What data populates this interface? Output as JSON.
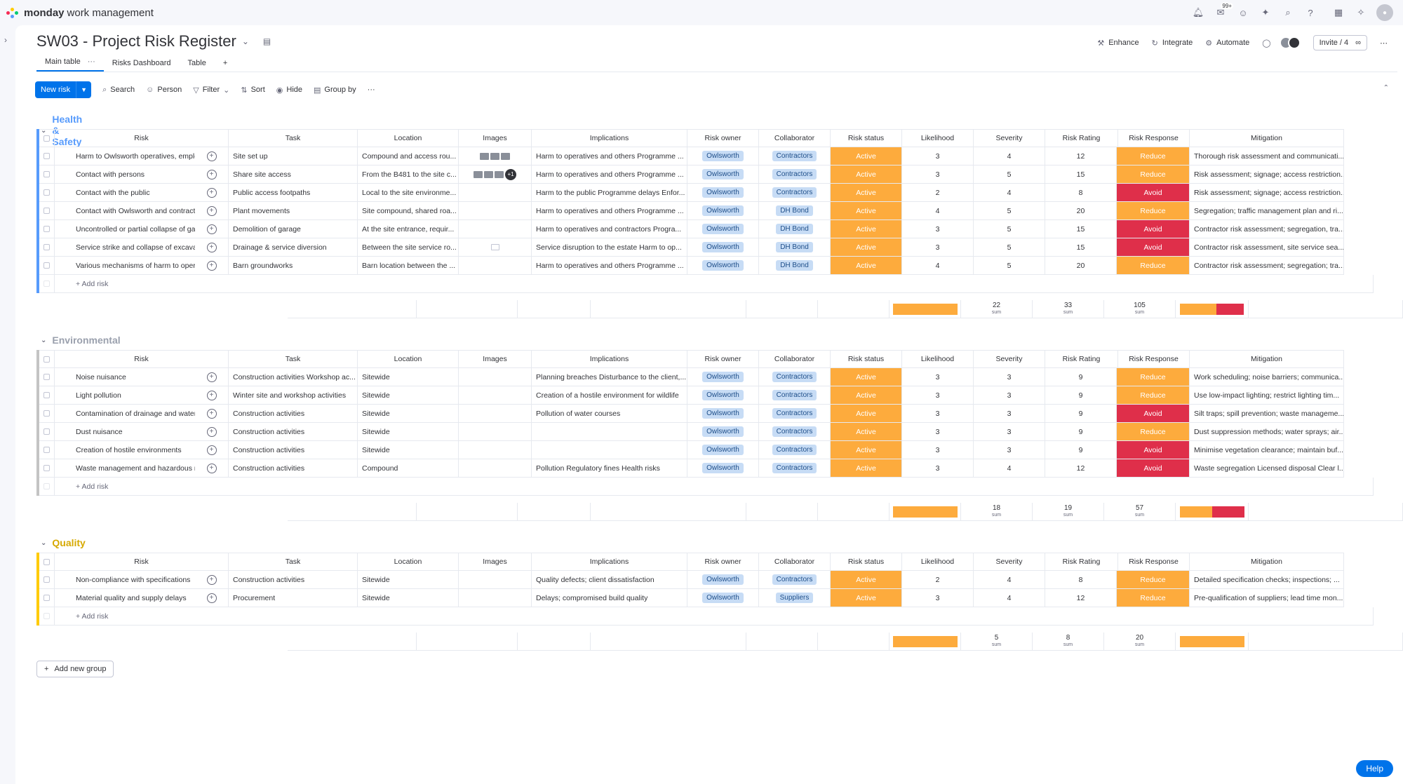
{
  "app": {
    "brand": "monday",
    "brand_sub": "work management"
  },
  "topbar": {
    "notifications_badge": "99+"
  },
  "board": {
    "title": "SW03 - Project Risk Register",
    "views": [
      {
        "label": "Main table",
        "active": true
      },
      {
        "label": "Risks Dashboard",
        "active": false
      },
      {
        "label": "Table",
        "active": false
      }
    ],
    "add_view": "+",
    "actions": {
      "enhance": "Enhance",
      "integrate": "Integrate",
      "automate": "Automate",
      "invite": "Invite / 4"
    }
  },
  "toolbar": {
    "new_label": "New risk",
    "search": "Search",
    "person": "Person",
    "filter": "Filter",
    "sort": "Sort",
    "hide": "Hide",
    "group_by": "Group by",
    "more": "···"
  },
  "columns": [
    "Risk",
    "Task",
    "Location",
    "Images",
    "Implications",
    "Risk owner",
    "Collaborator",
    "Risk status",
    "Likelihood",
    "Severity",
    "Risk Rating",
    "Risk Response",
    "Mitigation"
  ],
  "colors": {
    "active": "#fdab3d",
    "reduce": "#fdab3d",
    "avoid": "#df2f4a",
    "health": "#579bfc",
    "env": "#c4c4c4",
    "quality": "#ffcb00"
  },
  "add_item_label": "+ Add risk",
  "sum_label": "sum",
  "groups": [
    {
      "title": "Health & Safety",
      "color": "#579bfc",
      "rows": [
        {
          "risk": "Harm to Owlsworth operatives, employees and...",
          "task": "Site set up",
          "location": "Compound and access rou...",
          "images": "thumbs3",
          "implications": "Harm to operatives and others Programme ...",
          "owner": "Owlsworth",
          "collab": "Contractors",
          "status": "Active",
          "likelihood": "3",
          "severity": "4",
          "rating": "12",
          "response": "Reduce",
          "mitigation": "Thorough risk assessment and communicati..."
        },
        {
          "risk": "Contact with persons",
          "task": "Share site access",
          "location": "From the B481 to the site c...",
          "images": "thumbs3plus",
          "implications": "Harm to operatives and others Programme ...",
          "owner": "Owlsworth",
          "collab": "Contractors",
          "status": "Active",
          "likelihood": "3",
          "severity": "5",
          "rating": "15",
          "response": "Reduce",
          "mitigation": "Risk assessment; signage; access restriction..."
        },
        {
          "risk": "Contact with the public",
          "task": "Public access footpaths",
          "location": "Local to the site environme...",
          "images": "",
          "implications": "Harm to the public Programme delays Enfor...",
          "owner": "Owlsworth",
          "collab": "Contractors",
          "status": "Active",
          "likelihood": "2",
          "severity": "4",
          "rating": "8",
          "response": "Avoid",
          "mitigation": "Risk assessment; signage; access restriction..."
        },
        {
          "risk": "Contact with Owlsworth and contractors plant",
          "task": "Plant movements",
          "location": "Site compound, shared roa...",
          "images": "",
          "implications": "Harm to operatives and others Programme ...",
          "owner": "Owlsworth",
          "collab": "DH Bond",
          "status": "Active",
          "likelihood": "4",
          "severity": "5",
          "rating": "20",
          "response": "Reduce",
          "mitigation": "Segregation; traffic management plan and ri..."
        },
        {
          "risk": "Uncontrolled or partial collapse of garage",
          "task": "Demolition of garage",
          "location": "At the site entrance, requir...",
          "images": "",
          "implications": "Harm to operatives and contractors Progra...",
          "owner": "Owlsworth",
          "collab": "DH Bond",
          "status": "Active",
          "likelihood": "3",
          "severity": "5",
          "rating": "15",
          "response": "Avoid",
          "mitigation": "Contractor risk assessment; segregation, tra..."
        },
        {
          "risk": "Service strike and collapse of excavations etc",
          "task": "Drainage & service diversion",
          "location": "Between the site service ro...",
          "images": "doc",
          "implications": "Service disruption to the estate Harm to op...",
          "owner": "Owlsworth",
          "collab": "DH Bond",
          "status": "Active",
          "likelihood": "3",
          "severity": "5",
          "rating": "15",
          "response": "Avoid",
          "mitigation": "Contractor risk assessment, site service sea..."
        },
        {
          "risk": "Various mechanisms of harm to operatives and...",
          "task": "Barn groundworks",
          "location": "Barn location between the ...",
          "images": "",
          "implications": "Harm to operatives and others Programme ...",
          "owner": "Owlsworth",
          "collab": "DH Bond",
          "status": "Active",
          "likelihood": "4",
          "severity": "5",
          "rating": "20",
          "response": "Reduce",
          "mitigation": "Contractor risk assessment; segregation; tra..."
        }
      ],
      "sums": {
        "likelihood": "22",
        "severity": "33",
        "rating": "105",
        "reduce_share": 0.57
      }
    },
    {
      "title": "Environmental",
      "color": "#c4c4c4",
      "rows": [
        {
          "risk": "Noise nuisance",
          "task": "Construction activities Workshop ac...",
          "location": "Sitewide",
          "images": "",
          "implications": "Planning breaches Disturbance to the client,...",
          "owner": "Owlsworth",
          "collab": "Contractors",
          "status": "Active",
          "likelihood": "3",
          "severity": "3",
          "rating": "9",
          "response": "Reduce",
          "mitigation": "Work scheduling; noise barriers; communica..."
        },
        {
          "risk": "Light pollution",
          "task": "Winter site and workshop activities",
          "location": "Sitewide",
          "images": "",
          "implications": "Creation of a hostile environment for wildlife",
          "owner": "Owlsworth",
          "collab": "Contractors",
          "status": "Active",
          "likelihood": "3",
          "severity": "3",
          "rating": "9",
          "response": "Reduce",
          "mitigation": "Use low-impact lighting; restrict lighting tim..."
        },
        {
          "risk": "Contamination of drainage and water courses",
          "task": "Construction activities",
          "location": "Sitewide",
          "images": "",
          "implications": "Pollution of water courses",
          "owner": "Owlsworth",
          "collab": "Contractors",
          "status": "Active",
          "likelihood": "3",
          "severity": "3",
          "rating": "9",
          "response": "Avoid",
          "mitigation": "Silt traps; spill prevention; waste manageme..."
        },
        {
          "risk": "Dust nuisance",
          "task": "Construction activities",
          "location": "Sitewide",
          "images": "",
          "implications": "",
          "owner": "Owlsworth",
          "collab": "Contractors",
          "status": "Active",
          "likelihood": "3",
          "severity": "3",
          "rating": "9",
          "response": "Reduce",
          "mitigation": "Dust suppression methods; water sprays; air..."
        },
        {
          "risk": "Creation of hostile environments",
          "task": "Construction activities",
          "location": "Sitewide",
          "images": "",
          "implications": "",
          "owner": "Owlsworth",
          "collab": "Contractors",
          "status": "Active",
          "likelihood": "3",
          "severity": "3",
          "rating": "9",
          "response": "Avoid",
          "mitigation": "Minimise vegetation clearance; maintain buf..."
        },
        {
          "risk": "Waste management and hazardous materials",
          "task": "Construction activities",
          "location": "Compound",
          "images": "",
          "implications": "Pollution Regulatory fines Health risks",
          "owner": "Owlsworth",
          "collab": "Contractors",
          "status": "Active",
          "likelihood": "3",
          "severity": "4",
          "rating": "12",
          "response": "Avoid",
          "mitigation": "Waste segregation Licensed disposal Clear l..."
        }
      ],
      "sums": {
        "likelihood": "18",
        "severity": "19",
        "rating": "57",
        "reduce_share": 0.5
      }
    },
    {
      "title": "Quality",
      "color": "#ffcb00",
      "rows": [
        {
          "risk": "Non-compliance with specifications",
          "task": "Construction activities",
          "location": "Sitewide",
          "images": "",
          "implications": "Quality defects; client dissatisfaction",
          "owner": "Owlsworth",
          "collab": "Contractors",
          "status": "Active",
          "likelihood": "2",
          "severity": "4",
          "rating": "8",
          "response": "Reduce",
          "mitigation": "Detailed specification checks; inspections; ..."
        },
        {
          "risk": "Material quality and supply delays",
          "task": "Procurement",
          "location": "Sitewide",
          "images": "",
          "implications": "Delays; compromised build quality",
          "owner": "Owlsworth",
          "collab": "Suppliers",
          "status": "Active",
          "likelihood": "3",
          "severity": "4",
          "rating": "12",
          "response": "Reduce",
          "mitigation": "Pre-qualification of suppliers; lead time mon..."
        }
      ],
      "sums": {
        "likelihood": "5",
        "severity": "8",
        "rating": "20",
        "reduce_share": 1.0
      }
    }
  ],
  "add_group": "Add new group",
  "help": "Help"
}
